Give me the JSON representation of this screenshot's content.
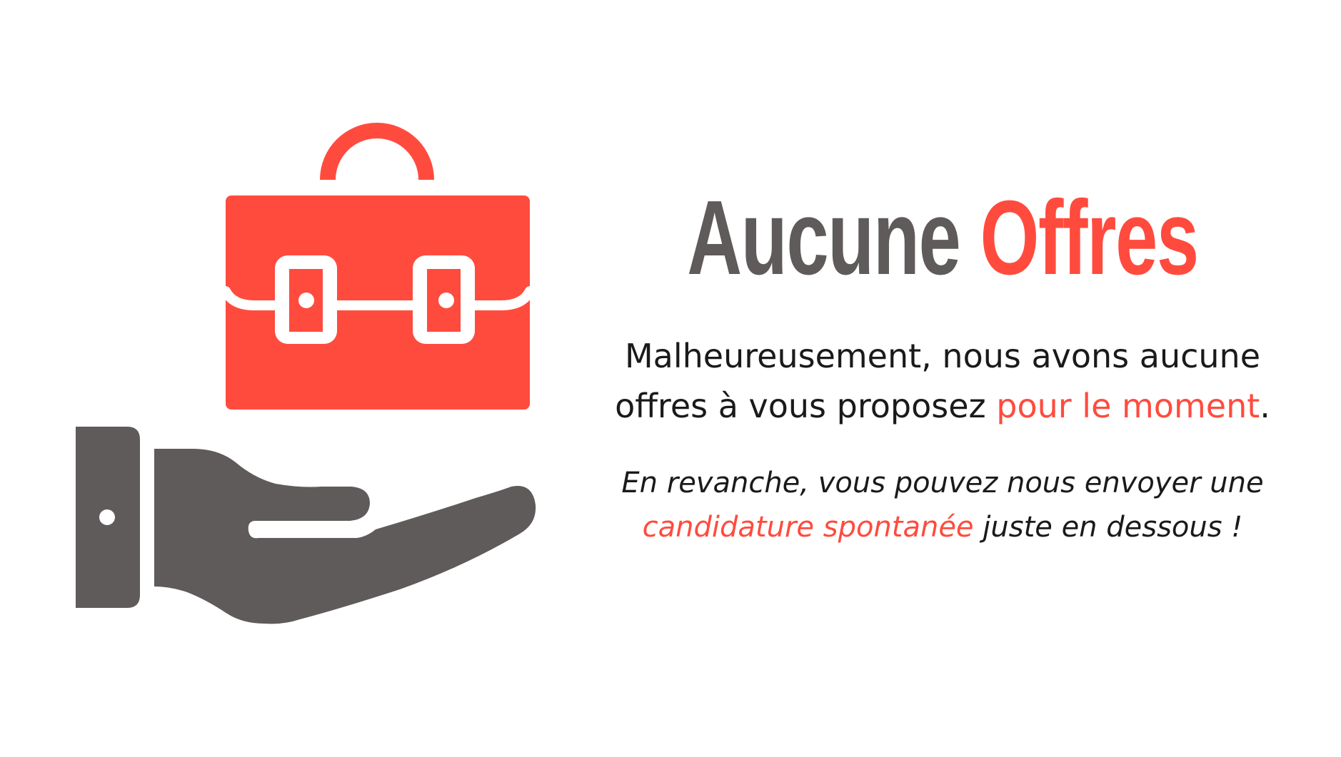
{
  "colors": {
    "accent": "#FF4B3E",
    "dark": "#5E5B5A"
  },
  "illustration": {
    "briefcase_icon": "briefcase-icon",
    "hand_icon": "open-hand-icon"
  },
  "title": {
    "word1": "Aucune",
    "word2": "Offres"
  },
  "message": {
    "line1": "Malheureusement, nous avons aucune",
    "line2_start": "offres à vous proposez ",
    "line2_highlight": "pour le moment",
    "line2_end": "."
  },
  "note": {
    "line1": "En revanche, vous pouvez nous envoyer une",
    "line2_highlight": "candidature spontanée",
    "line2_end": " juste en dessous !"
  }
}
